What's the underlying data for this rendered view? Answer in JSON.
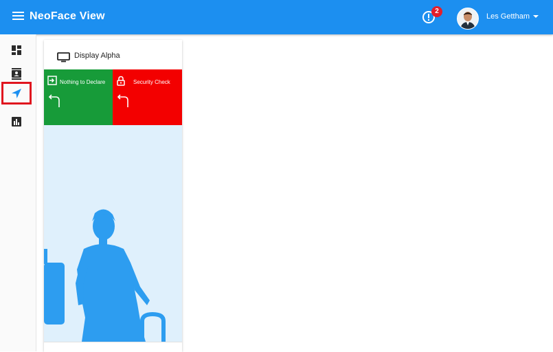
{
  "header": {
    "app_title": "NeoFace View",
    "alert_count": "2",
    "user_name": "Les Gettham",
    "menu_icon": "hamburger-icon",
    "alert_icon": "alert-circle-icon"
  },
  "sidebar": {
    "items": [
      {
        "name": "dashboard",
        "icon": "dashboard-icon",
        "active": false
      },
      {
        "name": "contacts",
        "icon": "contact-card-icon",
        "active": false
      },
      {
        "name": "navigation",
        "icon": "navigation-arrow-icon",
        "active": true
      },
      {
        "name": "reports",
        "icon": "bar-chart-icon",
        "active": false
      }
    ]
  },
  "display_card": {
    "title": "Display Alpha",
    "lanes": [
      {
        "label": "Nothing to Declare",
        "color": "#179b39",
        "icon": "exit-arrow-icon",
        "direction_icon": "turn-left-arrow-icon"
      },
      {
        "label": "Security Check",
        "color": "#f30000",
        "icon": "lock-icon",
        "direction_icon": "turn-left-arrow-icon"
      }
    ]
  },
  "colors": {
    "topbar": "#1c8ff0",
    "active_nav": "#1c8ff0",
    "highlight_border": "#e0141e",
    "silhouette": "#2d9df0",
    "illustration_bg": "#dff0fc"
  }
}
